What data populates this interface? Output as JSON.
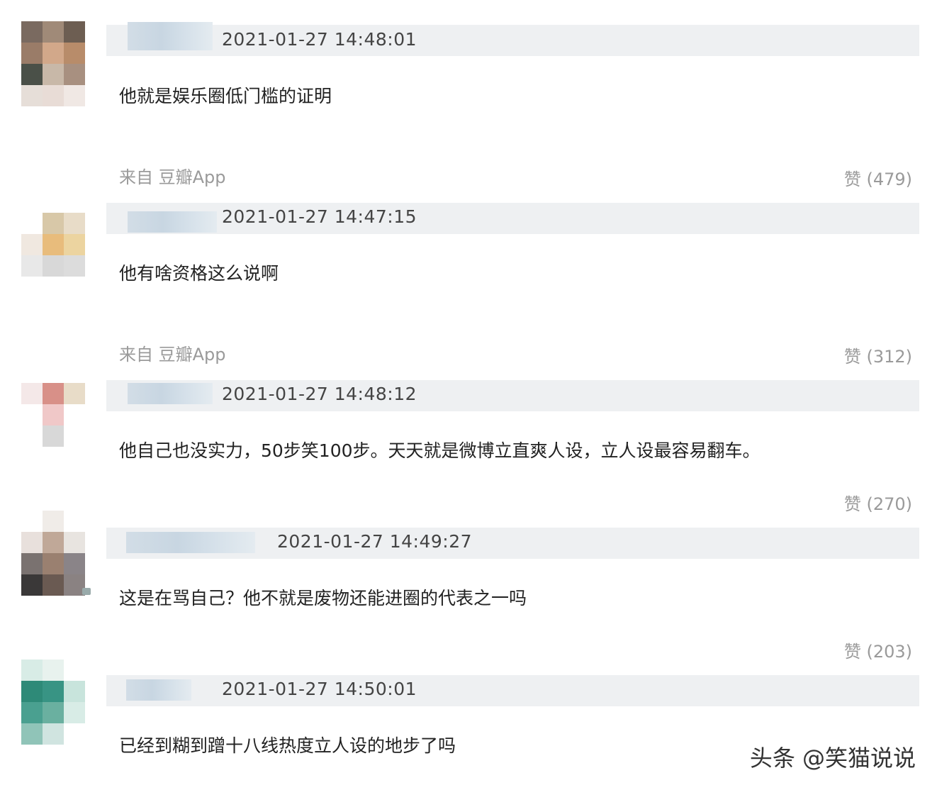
{
  "comments": [
    {
      "timestamp": "2021-01-27 14:48:01",
      "text": "他就是娱乐圈低门槛的证明",
      "source": "来自 豆瓣App",
      "likes": "赞 (479)",
      "avatar_colors": [
        "#7a6a60",
        "#a08a78",
        "#6d5e52",
        "#9a7c68",
        "#d2a88a",
        "#b88c6a",
        "#4a5048",
        "#c8b8a8",
        "#a89080",
        "#e6ded8",
        "#e8dcd6",
        "#f0e8e4"
      ]
    },
    {
      "timestamp": "2021-01-27 14:47:15",
      "text": "他有啥资格这么说啊",
      "source": "来自 豆瓣App",
      "likes": "赞 (312)",
      "avatar_colors": [
        "#ffffff",
        "#d8c8a8",
        "#e8dcc8",
        "#f0e8e0",
        "#e8bc7c",
        "#ecd4a0",
        "#e8e8e8",
        "#d8d8d8",
        "#dcdcdc",
        "#ffffff",
        "#ffffff",
        "#ffffff"
      ]
    },
    {
      "timestamp": "2021-01-27 14:48:12",
      "text": "他自己也没实力，50步笑100步。天天就是微博立直爽人设，立人设最容易翻车。",
      "likes": "赞 (270)",
      "avatar_colors": [
        "#f4e8e8",
        "#d89088",
        "#e8dcc8",
        "#ffffff",
        "#f0c8c8",
        "#ffffff",
        "#ffffff",
        "#d8d8d8",
        "#ffffff",
        "#ffffff",
        "#ffffff",
        "#ffffff"
      ]
    },
    {
      "timestamp": "2021-01-27 14:49:27",
      "text": "这是在骂自己？他不就是废物还能进圈的代表之一吗",
      "likes": "赞 (203)",
      "avatar_colors": [
        "#ffffff",
        "#f0ece8",
        "#ffffff",
        "#e8e0dc",
        "#c0a898",
        "#e8e4e0",
        "#7a7270",
        "#9a8070",
        "#8a8488",
        "#3a3838",
        "#6a5a52",
        "#8a8282"
      ]
    },
    {
      "timestamp": "2021-01-27 14:50:01",
      "text": "已经到糊到蹭十八线热度立人设的地步了吗",
      "avatar_colors": [
        "#d8ece6",
        "#e8f2ee",
        "#ffffff",
        "#2e8a78",
        "#389484",
        "#c8e4dc",
        "#4aa090",
        "#6ab0a0",
        "#d8ece6",
        "#90c4b8",
        "#d0e4e0",
        "#ffffff"
      ]
    }
  ],
  "watermark": "头条 @笑猫说说"
}
